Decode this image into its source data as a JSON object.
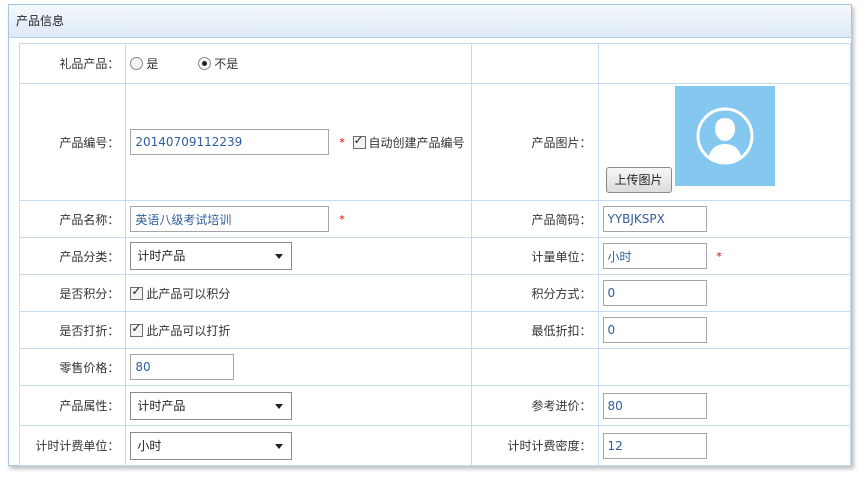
{
  "panel": {
    "title": "产品信息"
  },
  "gift": {
    "label": "礼品产品：",
    "options": [
      {
        "label": "是",
        "selected": false
      },
      {
        "label": "不是",
        "selected": true
      }
    ]
  },
  "product_code": {
    "label": "产品编号：",
    "value": "20140709112239",
    "required_mark": "*",
    "auto_create": {
      "label": "自动创建产品编号",
      "checked": true
    }
  },
  "product_image": {
    "label": "产品图片：",
    "upload_label": "上传图片",
    "avatar_bg": "#84c8ef"
  },
  "product_name": {
    "label": "产品名称：",
    "value": "英语八级考试培训",
    "required_mark": "*"
  },
  "short_code": {
    "label": "产品简码：",
    "value": "YYBJKSPX"
  },
  "category": {
    "label": "产品分类：",
    "selected": "计时产品"
  },
  "unit": {
    "label": "计量单位：",
    "value": "小时",
    "required_mark": "*"
  },
  "points": {
    "label": "是否积分：",
    "checkbox_label": "此产品可以积分",
    "checked": true
  },
  "points_method": {
    "label": "积分方式：",
    "value": "0"
  },
  "discount": {
    "label": "是否打折：",
    "checkbox_label": "此产品可以打折",
    "checked": true
  },
  "min_discount": {
    "label": "最低折扣：",
    "value": "0"
  },
  "retail_price": {
    "label": "零售价格：",
    "value": "80"
  },
  "attribute": {
    "label": "产品属性：",
    "selected": "计时产品"
  },
  "ref_price": {
    "label": "参考进价：",
    "value": "80"
  },
  "billing_unit": {
    "label": "计时计费单位：",
    "selected": "小时"
  },
  "billing_density": {
    "label": "计时计费密度：",
    "value": "12"
  },
  "colors": {
    "value_text": "#2f5e9c",
    "required": "#dd0000",
    "border": "#c6dbef"
  }
}
